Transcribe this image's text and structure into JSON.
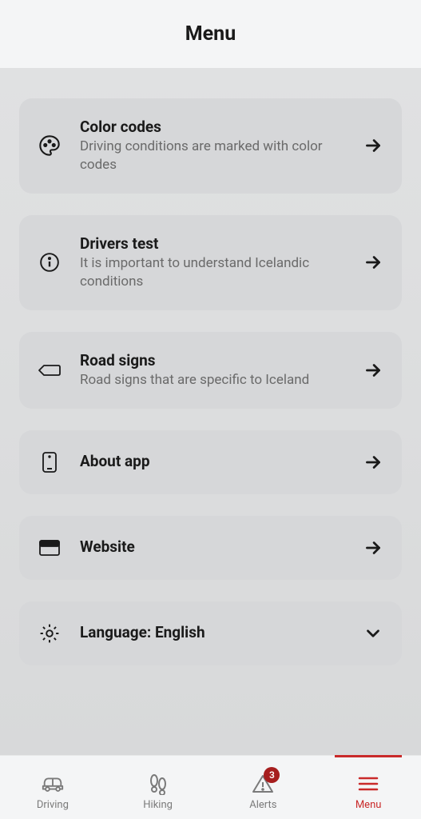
{
  "header": {
    "title": "Menu"
  },
  "menu": {
    "items": [
      {
        "title": "Color codes",
        "subtitle": "Driving conditions are marked with color codes"
      },
      {
        "title": "Drivers test",
        "subtitle": "It is important to understand Icelandic conditions"
      },
      {
        "title": "Road signs",
        "subtitle": "Road signs that are specific to Iceland"
      },
      {
        "title": "About app",
        "subtitle": ""
      },
      {
        "title": "Website",
        "subtitle": ""
      },
      {
        "title": "Language: English",
        "subtitle": ""
      }
    ]
  },
  "nav": {
    "items": [
      {
        "label": "Driving"
      },
      {
        "label": "Hiking"
      },
      {
        "label": "Alerts",
        "badge": "3"
      },
      {
        "label": "Menu"
      }
    ]
  }
}
